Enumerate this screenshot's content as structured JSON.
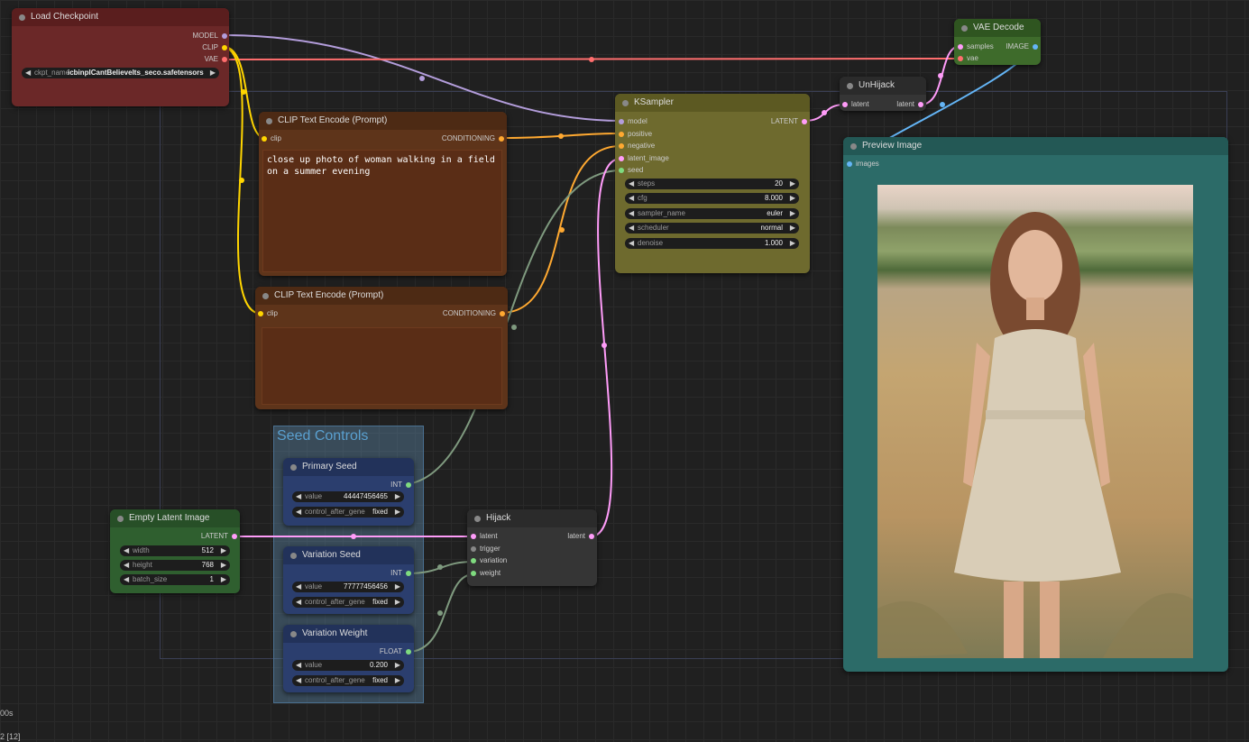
{
  "nodes": {
    "load_checkpoint": {
      "title": "Load Checkpoint",
      "outputs": [
        "MODEL",
        "CLIP",
        "VAE"
      ],
      "widget": {
        "name": "ckpt_name",
        "value": "icbinpICantBelieveIts_seco.safetensors"
      }
    },
    "vae_decode": {
      "title": "VAE Decode",
      "inputs": [
        "samples",
        "vae"
      ],
      "output": "IMAGE"
    },
    "ksampler": {
      "title": "KSampler",
      "inputs": [
        "model",
        "positive",
        "negative",
        "latent_image",
        "seed"
      ],
      "output": "LATENT",
      "widgets": [
        {
          "name": "steps",
          "value": "20"
        },
        {
          "name": "cfg",
          "value": "8.000"
        },
        {
          "name": "sampler_name",
          "value": "euler"
        },
        {
          "name": "scheduler",
          "value": "normal"
        },
        {
          "name": "denoise",
          "value": "1.000"
        }
      ]
    },
    "unhijack": {
      "title": "UnHijack",
      "input": "latent",
      "output": "latent"
    },
    "clip_pos": {
      "title": "CLIP Text Encode (Prompt)",
      "input": "clip",
      "output": "CONDITIONING",
      "text": "close up photo of woman walking in a field\non a summer evening"
    },
    "clip_neg": {
      "title": "CLIP Text Encode (Prompt)",
      "input": "clip",
      "output": "CONDITIONING",
      "text": ""
    },
    "preview": {
      "title": "Preview Image",
      "input": "images"
    },
    "empty_latent": {
      "title": "Empty Latent Image",
      "output": "LATENT",
      "widgets": [
        {
          "name": "width",
          "value": "512"
        },
        {
          "name": "height",
          "value": "768"
        },
        {
          "name": "batch_size",
          "value": "1"
        }
      ]
    },
    "primary_seed": {
      "title": "Primary Seed",
      "output": "INT",
      "widgets": [
        {
          "name": "value",
          "value": "44447456465"
        },
        {
          "name": "control_after_gene",
          "value": "fixed"
        }
      ]
    },
    "variation_seed": {
      "title": "Variation Seed",
      "output": "INT",
      "widgets": [
        {
          "name": "value",
          "value": "77777456456"
        },
        {
          "name": "control_after_gene",
          "value": "fixed"
        }
      ]
    },
    "variation_weight": {
      "title": "Variation Weight",
      "output": "FLOAT",
      "widgets": [
        {
          "name": "value",
          "value": "0.200"
        },
        {
          "name": "control_after_gene",
          "value": "fixed"
        }
      ]
    },
    "hijack": {
      "title": "Hijack",
      "inputs": [
        "latent",
        "trigger",
        "variation",
        "weight"
      ],
      "output": "latent"
    }
  },
  "group": {
    "title": "Seed Controls"
  },
  "footer": {
    "line1": "00s",
    "line2": "2 [12]"
  },
  "colors": {
    "model_link": "#b39ddb",
    "clip_link": "#ffd500",
    "vae_link": "#ff6e6e",
    "conditioning_link": "#ffa931",
    "latent_link": "#ff9cf9",
    "image_link": "#64b5f6",
    "int_link": "#7f9a7f"
  },
  "icons": {
    "arrow_left": "◀",
    "arrow_right": "▶"
  }
}
